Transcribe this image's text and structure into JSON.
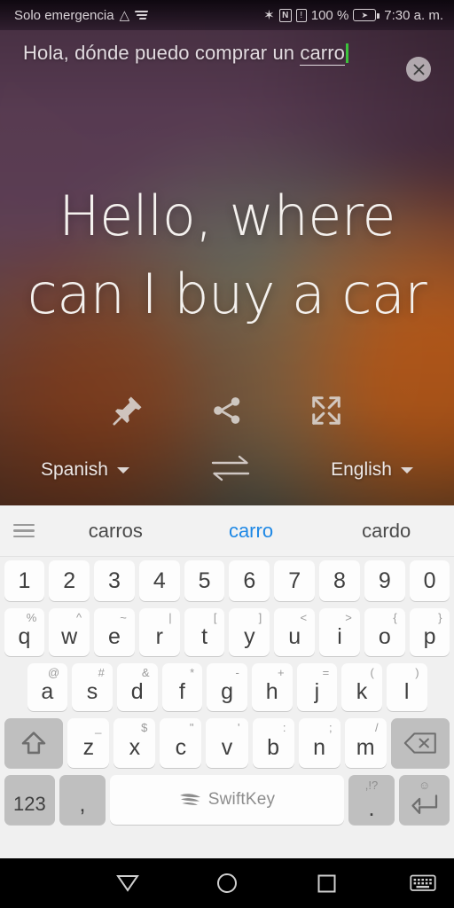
{
  "status_bar": {
    "carrier": "Solo emergencia",
    "warning_icon": "warning-triangle-icon",
    "signal_icon": "signal-icon",
    "bluetooth_icon": "bluetooth-icon",
    "bluetooth_glyph": "✶",
    "nfc_label": "N",
    "alert_label": "!",
    "battery_percent": "100 %",
    "battery_icon": "battery-charging-icon",
    "clock": "7:30 a. m."
  },
  "translator": {
    "source_text_prefix": "Hola, dónde puedo comprar un ",
    "source_text_composing": "carro",
    "clear_button_label": "×",
    "translated_text": "Hello, where can I buy a car",
    "actions": [
      {
        "name": "pin-icon",
        "label": "Pin"
      },
      {
        "name": "share-icon",
        "label": "Share"
      },
      {
        "name": "fullscreen-icon",
        "label": "Fullscreen"
      }
    ],
    "source_language": "Spanish",
    "target_language": "English",
    "swap_icon": "swap-arrows-icon"
  },
  "keyboard": {
    "menu_icon": "hamburger-menu-icon",
    "suggestions": [
      {
        "text": "carros",
        "active": false
      },
      {
        "text": "carro",
        "active": true
      },
      {
        "text": "cardo",
        "active": false
      }
    ],
    "accent_color": "#1e88e5",
    "row_numbers": [
      {
        "main": "1"
      },
      {
        "main": "2"
      },
      {
        "main": "3"
      },
      {
        "main": "4"
      },
      {
        "main": "5"
      },
      {
        "main": "6"
      },
      {
        "main": "7"
      },
      {
        "main": "8"
      },
      {
        "main": "9"
      },
      {
        "main": "0"
      }
    ],
    "row_top": [
      {
        "main": "q",
        "alt": "%"
      },
      {
        "main": "w",
        "alt": "^"
      },
      {
        "main": "e",
        "alt": "~"
      },
      {
        "main": "r",
        "alt": "|"
      },
      {
        "main": "t",
        "alt": "["
      },
      {
        "main": "y",
        "alt": "]"
      },
      {
        "main": "u",
        "alt": "<"
      },
      {
        "main": "i",
        "alt": ">"
      },
      {
        "main": "o",
        "alt": "{"
      },
      {
        "main": "p",
        "alt": "}"
      }
    ],
    "row_home": [
      {
        "main": "a",
        "alt": "@"
      },
      {
        "main": "s",
        "alt": "#"
      },
      {
        "main": "d",
        "alt": "&"
      },
      {
        "main": "f",
        "alt": "*"
      },
      {
        "main": "g",
        "alt": "-"
      },
      {
        "main": "h",
        "alt": "+"
      },
      {
        "main": "j",
        "alt": "="
      },
      {
        "main": "k",
        "alt": "("
      },
      {
        "main": "l",
        "alt": ")"
      }
    ],
    "row_bottom": [
      {
        "main": "z",
        "alt": "_"
      },
      {
        "main": "x",
        "alt": "$"
      },
      {
        "main": "c",
        "alt": "\""
      },
      {
        "main": "v",
        "alt": "'"
      },
      {
        "main": "b",
        "alt": ":"
      },
      {
        "main": "n",
        "alt": ";"
      },
      {
        "main": "m",
        "alt": "/"
      }
    ],
    "shift_icon": "shift-icon",
    "backspace_icon": "backspace-icon",
    "numeric_key_label": "123",
    "comma_key_label": ",",
    "space_label": "SwiftKey",
    "space_icon": "swiftkey-logo-icon",
    "period_key_label": ".",
    "period_key_alt": ",!?",
    "enter_icon": "enter-icon",
    "emoji_key_alt": "☺"
  },
  "nav_bar": {
    "back_icon": "back-triangle-icon",
    "home_icon": "home-circle-icon",
    "recents_icon": "recents-square-icon",
    "keyboard_icon": "hide-keyboard-icon"
  }
}
